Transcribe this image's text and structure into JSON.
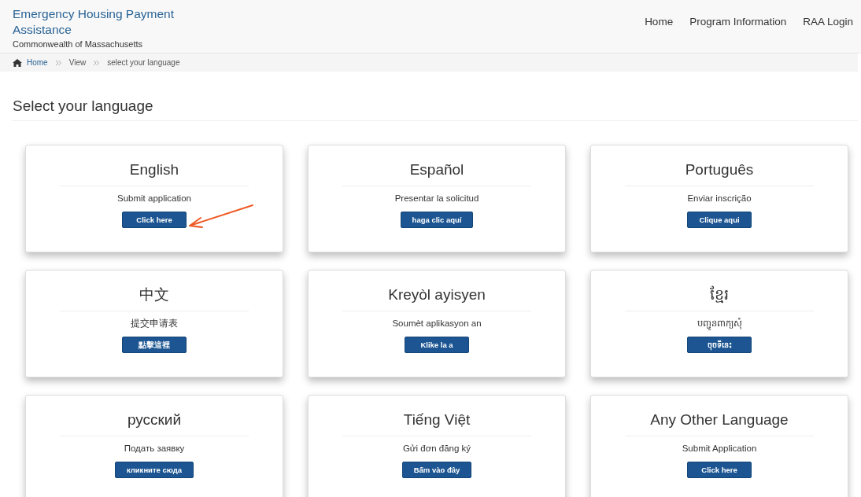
{
  "header": {
    "title": "Emergency Housing Payment Assistance",
    "subtitle": "Commonwealth of Massachusetts",
    "nav": [
      "Home",
      "Program Information",
      "RAA Login"
    ]
  },
  "breadcrumb": [
    {
      "label": "Home",
      "kind": "link"
    },
    {
      "label": "View",
      "kind": "text"
    },
    {
      "label": "select your language",
      "kind": "text"
    }
  ],
  "heading": "Select your language",
  "cards": [
    {
      "language": "English",
      "action": "Submit application",
      "button": "Click here",
      "annotated": true
    },
    {
      "language": "Español",
      "action": "Presentar la solicitud",
      "button": "haga clic aquí",
      "annotated": false
    },
    {
      "language": "Português",
      "action": "Enviar inscrição",
      "button": "Clique aqui",
      "annotated": false
    },
    {
      "language": "中文",
      "action": "提交申请表",
      "button": "點擊這裡",
      "annotated": false
    },
    {
      "language": "Kreyòl ayisyen",
      "action": "Soumèt aplikasyon an",
      "button": "Klike la a",
      "annotated": false
    },
    {
      "language": "ខ្មែរ",
      "action": "បញ្ជូនពាក្យសុំ",
      "button": "ចុចទីនេះ",
      "annotated": false
    },
    {
      "language": "русский",
      "action": "Подать заявку",
      "button": "кликните сюда",
      "annotated": false
    },
    {
      "language": "Tiếng Việt",
      "action": "Gửi đơn đăng ký",
      "button": "Bấm vào đây",
      "annotated": false
    },
    {
      "language": "Any Other Language",
      "action": "Submit Application",
      "button": "Click here",
      "annotated": false
    }
  ]
}
